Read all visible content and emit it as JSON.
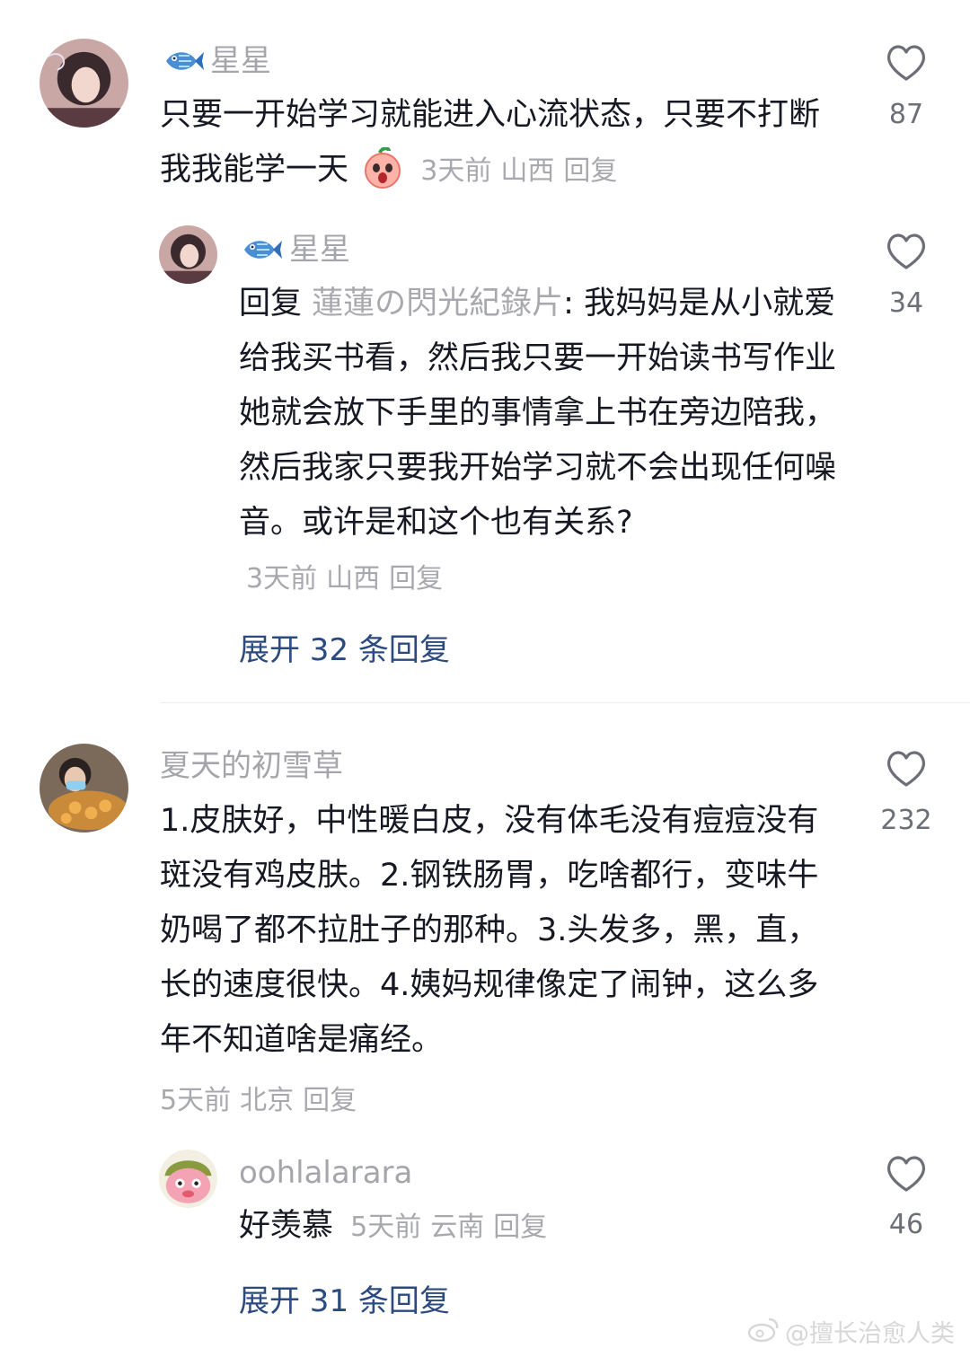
{
  "comments": [
    {
      "username": "星星",
      "text": "只要一开始学习就能进入心流状态，只要不打断我我能学一天",
      "emoji": "crying-peach-emoji",
      "time": "3天前",
      "location": "山西",
      "reply_label": "回复",
      "likes": "87",
      "replies": [
        {
          "username": "星星",
          "reply_prefix": "回复",
          "reply_to": "蓮蓮の閃光紀錄片",
          "text": ": 我妈妈是从小就爱给我买书看，然后我只要一开始读书写作业她就会放下手里的事情拿上书在旁边陪我，然后我家只要我开始学习就不会出现任何噪音。或许是和这个也有关系?",
          "time": "3天前",
          "location": "山西",
          "reply_label": "回复",
          "likes": "34"
        }
      ],
      "expand_label": "展开 32 条回复"
    },
    {
      "username": "夏天的初雪草",
      "text": "1.皮肤好，中性暖白皮，没有体毛没有痘痘没有斑没有鸡皮肤。2.钢铁肠胃，吃啥都行，变味牛奶喝了都不拉肚子的那种。3.头发多，黑，直，长的速度很快。4.姨妈规律像定了闹钟，这么多年不知道啥是痛经。",
      "time": "5天前",
      "location": "北京",
      "reply_label": "回复",
      "likes": "232",
      "replies": [
        {
          "username": "oohlalarara",
          "text": "好羡慕",
          "time": "5天前",
          "location": "云南",
          "reply_label": "回复",
          "likes": "46"
        }
      ],
      "expand_label": "展开 31 条回复"
    }
  ],
  "watermark": "@擅长治愈人类",
  "icons": {
    "like": "heart-outline-icon",
    "fan_badge": "fish-badge-icon",
    "watermark": "weibo-icon"
  },
  "colors": {
    "text": "#161823",
    "muted": "#a8a9ae",
    "link": "#2b4a80",
    "badge": "#4a8fd6"
  }
}
